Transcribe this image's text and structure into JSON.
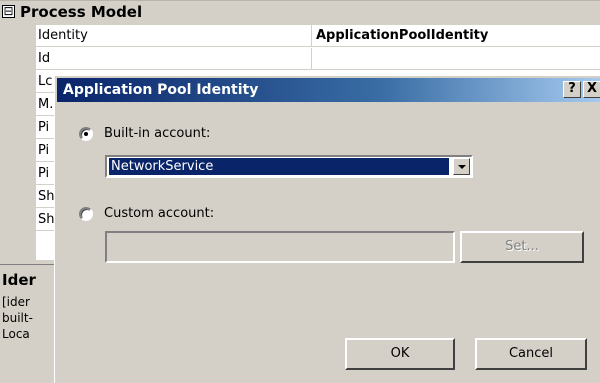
{
  "property_grid": {
    "category": {
      "toggle": "⊟",
      "label": "Process Model"
    },
    "rows": [
      {
        "name": "Identity",
        "value": "ApplicationPoolIdentity"
      },
      {
        "name": "Id",
        "value": ""
      },
      {
        "name": "Lc",
        "value": ""
      },
      {
        "name": "M.",
        "value": ""
      },
      {
        "name": "Pi",
        "value": ""
      },
      {
        "name": "Pi",
        "value": ""
      },
      {
        "name": "Pi",
        "value": ""
      },
      {
        "name": "Sh",
        "value": ""
      },
      {
        "name": "Sh",
        "value": ""
      }
    ],
    "description": {
      "title": "Ider",
      "lines": [
        "[ider",
        "built-",
        "Loca"
      ]
    }
  },
  "dialog": {
    "title": "Application Pool Identity",
    "help_button": "?",
    "close_button": "X",
    "builtin_label": "Built-in account:",
    "builtin_selected": true,
    "builtin_value": "NetworkService",
    "custom_label": "Custom account:",
    "custom_selected": false,
    "custom_value": "",
    "set_button": "Set...",
    "ok_button": "OK",
    "cancel_button": "Cancel"
  },
  "colors": {
    "titlebar_start": "#0a246a",
    "titlebar_end": "#a6caf0",
    "selection": "#0a246a",
    "face": "#d4d0c8"
  }
}
